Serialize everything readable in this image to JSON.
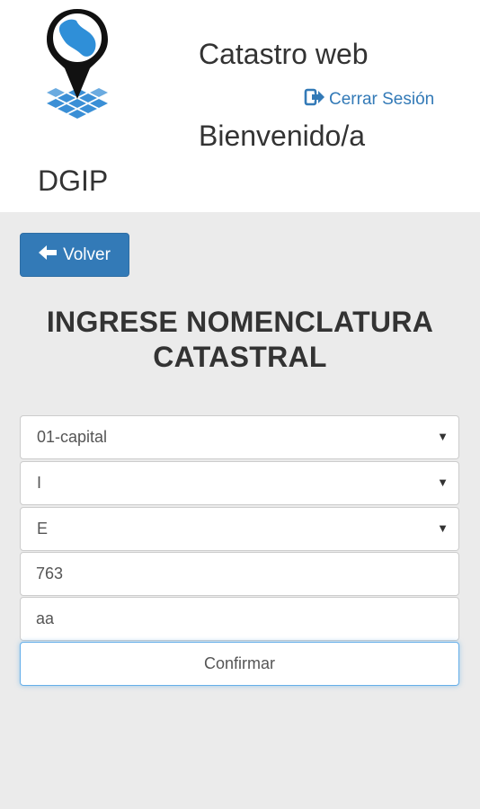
{
  "header": {
    "app_title": "Catastro web",
    "logout_label": "Cerrar Sesión",
    "welcome": "Bienvenido/a",
    "organization": "DGIP"
  },
  "icons": {
    "logo": "map-pin-logo-icon",
    "logout": "sign-out-icon",
    "back": "arrow-left-icon",
    "dropdown": "caret-down-icon"
  },
  "colors": {
    "primary": "#337ab7",
    "map_shape": "#2f8fd8",
    "grid": "#3a8fd6",
    "panel_bg": "#ebebeb",
    "focus_border": "#66afe9"
  },
  "main": {
    "back_label": "Volver",
    "title_line1": "INGRESE NOMENCLATURA",
    "title_line2": "CATASTRAL",
    "department_value": "01-capital",
    "field2_value": "I",
    "field3_value": "E",
    "field4_value": "763",
    "field5_value": "aa",
    "confirm_label": "Confirmar"
  }
}
